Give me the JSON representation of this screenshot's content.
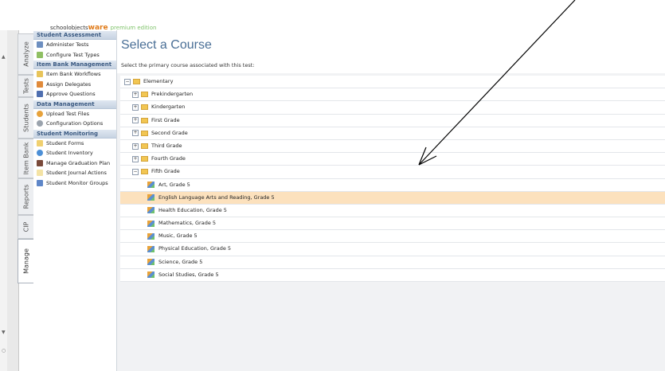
{
  "app": {
    "logo_part1": "schoolobjects",
    "logo_part2": "ware",
    "logo_part3": "premium edition"
  },
  "side_tabs": [
    "Analyze",
    "Tests",
    "Students",
    "Item Bank",
    "Reports",
    "CIP",
    "Manage"
  ],
  "menu": {
    "groups": [
      {
        "title": "Student Assessment",
        "items": [
          "Administer Tests",
          "Configure Test Types"
        ]
      },
      {
        "title": "Item Bank Management",
        "items": [
          "Item Bank Workflows",
          "Assign Delegates",
          "Approve Questions"
        ]
      },
      {
        "title": "Data Management",
        "items": [
          "Upload Test Files",
          "Configuration Options"
        ]
      },
      {
        "title": "Student Monitoring",
        "items": [
          "Student Forms",
          "Student Inventory",
          "Manage Graduation Plan",
          "Student Journal Actions",
          "Student Monitor Groups"
        ]
      }
    ]
  },
  "page": {
    "title": "Select a Course",
    "subtitle": "Select the primary course associated with this test:"
  },
  "tree": {
    "root": "Elementary",
    "grades": [
      "Prekindergarten",
      "Kindergarten",
      "First Grade",
      "Second Grade",
      "Third Grade",
      "Fourth Grade",
      "Fifth Grade"
    ],
    "courses": [
      "Art, Grade 5",
      "English Language Arts and Reading, Grade 5",
      "Health Education, Grade 5",
      "Mathematics, Grade 5",
      "Music, Grade 5",
      "Physical Education, Grade 5",
      "Science, Grade 5",
      "Social Studies, Grade 5"
    ],
    "selected_course": "English Language Arts and Reading, Grade 5"
  },
  "colors": {
    "group_header_text": "#3b5a82",
    "title_text": "#4a6f96",
    "selected_row": "#fce1bd"
  }
}
